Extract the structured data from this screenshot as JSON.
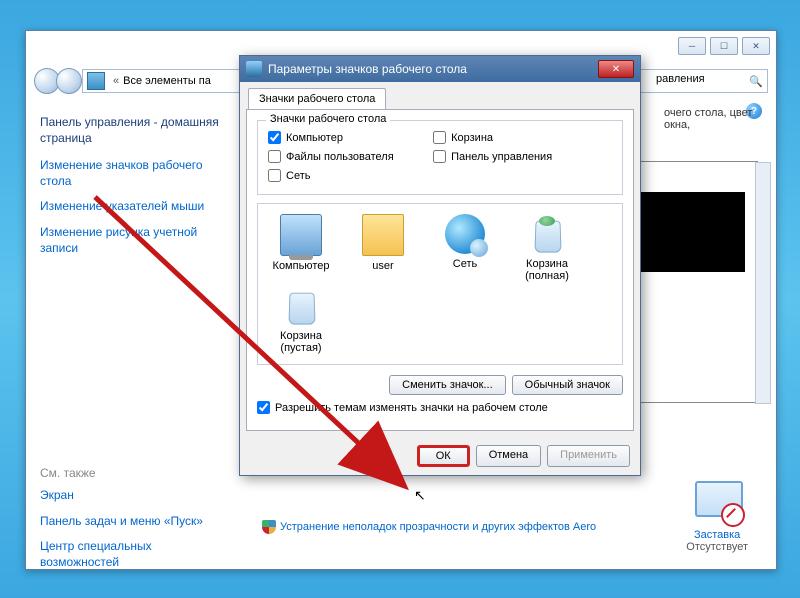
{
  "window": {
    "breadcrumb_prefix": "Все элементы па",
    "breadcrumb_suffix": "равления",
    "search_placeholder": ""
  },
  "sidebar": {
    "home": "Панель управления - домашняя страница",
    "links": [
      "Изменение значков рабочего стола",
      "Изменение указателей мыши",
      "Изменение рисунка учетной записи"
    ],
    "also_label": "См. также",
    "also": [
      "Экран",
      "Панель задач и меню «Пуск»",
      "Центр специальных возможностей"
    ]
  },
  "content": {
    "heading_fragment": "очего стола, цвет окна,",
    "screensaver_label": "Заставка",
    "screensaver_status": "Отсутствует",
    "aero_link": "Устранение неполадок прозрачности и других эффектов Aero"
  },
  "dialog": {
    "title": "Параметры значков рабочего стола",
    "tab": "Значки рабочего стола",
    "group_legend": "Значки рабочего стола",
    "checks": {
      "computer": "Компьютер",
      "userfiles": "Файлы пользователя",
      "network": "Сеть",
      "recycle": "Корзина",
      "cpanel": "Панель управления"
    },
    "computer_checked": true,
    "icons": {
      "computer": "Компьютер",
      "user": "user",
      "network": "Сеть",
      "bin_full": "Корзина (полная)",
      "bin_empty": "Корзина (пустая)"
    },
    "btn_change": "Сменить значок...",
    "btn_default": "Обычный значок",
    "allow_themes": "Разрешить темам изменять значки на рабочем столе",
    "allow_checked": true,
    "ok": "ОК",
    "cancel": "Отмена",
    "apply": "Применить"
  }
}
